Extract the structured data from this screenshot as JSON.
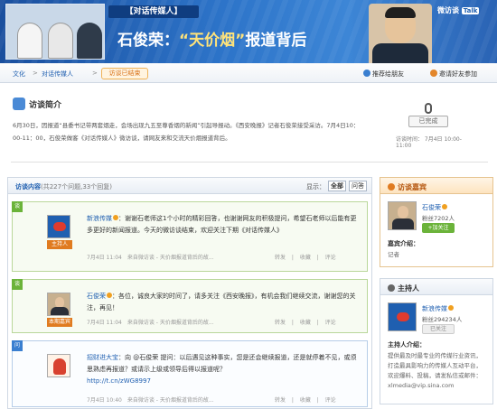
{
  "banner": {
    "tag": "【对话传媒人】",
    "headline_name": "石俊荣：",
    "headline_quote": "“天价烟”",
    "headline_rest": "报道背后",
    "talk_label": "微访谈",
    "talk_badge": "Talk"
  },
  "nav": {
    "crumb1": "文化",
    "crumb2": "对话传媒人",
    "sep": ">",
    "tab": "访谈已结束",
    "action1": "推荐给朋友",
    "action2": "邀请好友参加"
  },
  "intro": {
    "title": "访谈简介",
    "text": "6月30日，因报道“县委书记带两套烟走，会场出现九五至尊香烟的新闻”引起导报动。《西安晚报》记者石俊荣接受采访。7月4日10：00-11：00，石俊荣做客《对话传媒人》微访谈，请网友来和交流天价烟报道背后。",
    "status": "已完成",
    "time": "访谈时间： 7月4日 10:00-11:00"
  },
  "panel": {
    "title": "访谈内容",
    "count": "(共227个问题,33个回复)",
    "show_label": "显示：",
    "btn_all": "全部",
    "btn_qa": "问答",
    "items": [
      {
        "corner": "谈",
        "name": "新浪传媒",
        "text": "：谢谢石老师这1个小时的精彩回答，也谢谢网友的积极提问，希望石老师以后能有更多更好的新闻报道。今天的微访谈结束，欢迎关注下期《对话传媒人》",
        "role": "主持人",
        "time": "7月4日 11:04",
        "source": "来自微访谈 - 天价烟报道背后的故...",
        "actions": "转发 | 收藏 | 评论"
      },
      {
        "corner": "谈",
        "name": "石俊荣",
        "text": "：各位，诚良大家的时间了，请多关注《西安晚报》，有机会我们继续交流，谢谢您的关注，再见！",
        "role": "本期嘉宾",
        "time": "7月4日 11:04",
        "source": "来自微访谈 - 天价烟报道背后的故...",
        "actions": "转发 | 收藏 | 评论"
      },
      {
        "corner": "问",
        "name": "招财进大宝",
        "text": "：向 @石俊荣 提问：以后遇见这种事实，您是还会继续报道，还是就停着不见，或须思熟虑再报道？或请示上级或领导后得以报道呢？",
        "link": "http://t.cn/zWG8997",
        "time": "7月4日 10:40",
        "source": "来自微访谈 - 天价烟报道背后的故...",
        "actions": "转发 | 收藏 | 评论"
      }
    ]
  },
  "guest": {
    "title": "访谈嘉宾",
    "name": "石俊荣",
    "fans": "粉丝7202人",
    "follow": "+加关注",
    "intro_label": "嘉宾介绍：",
    "intro": "记者"
  },
  "host": {
    "title": "主持人",
    "name": "新浪传媒",
    "fans": "粉丝294234人",
    "follow": "已关注",
    "intro_label": "主持人介绍：",
    "intro": "提供最及时最专业的传媒行业资讯，打造最具影响力的传媒人互动平台，欢迎爆料、投稿，请发私信或邮件：xlmedia@vip.sina.com"
  }
}
